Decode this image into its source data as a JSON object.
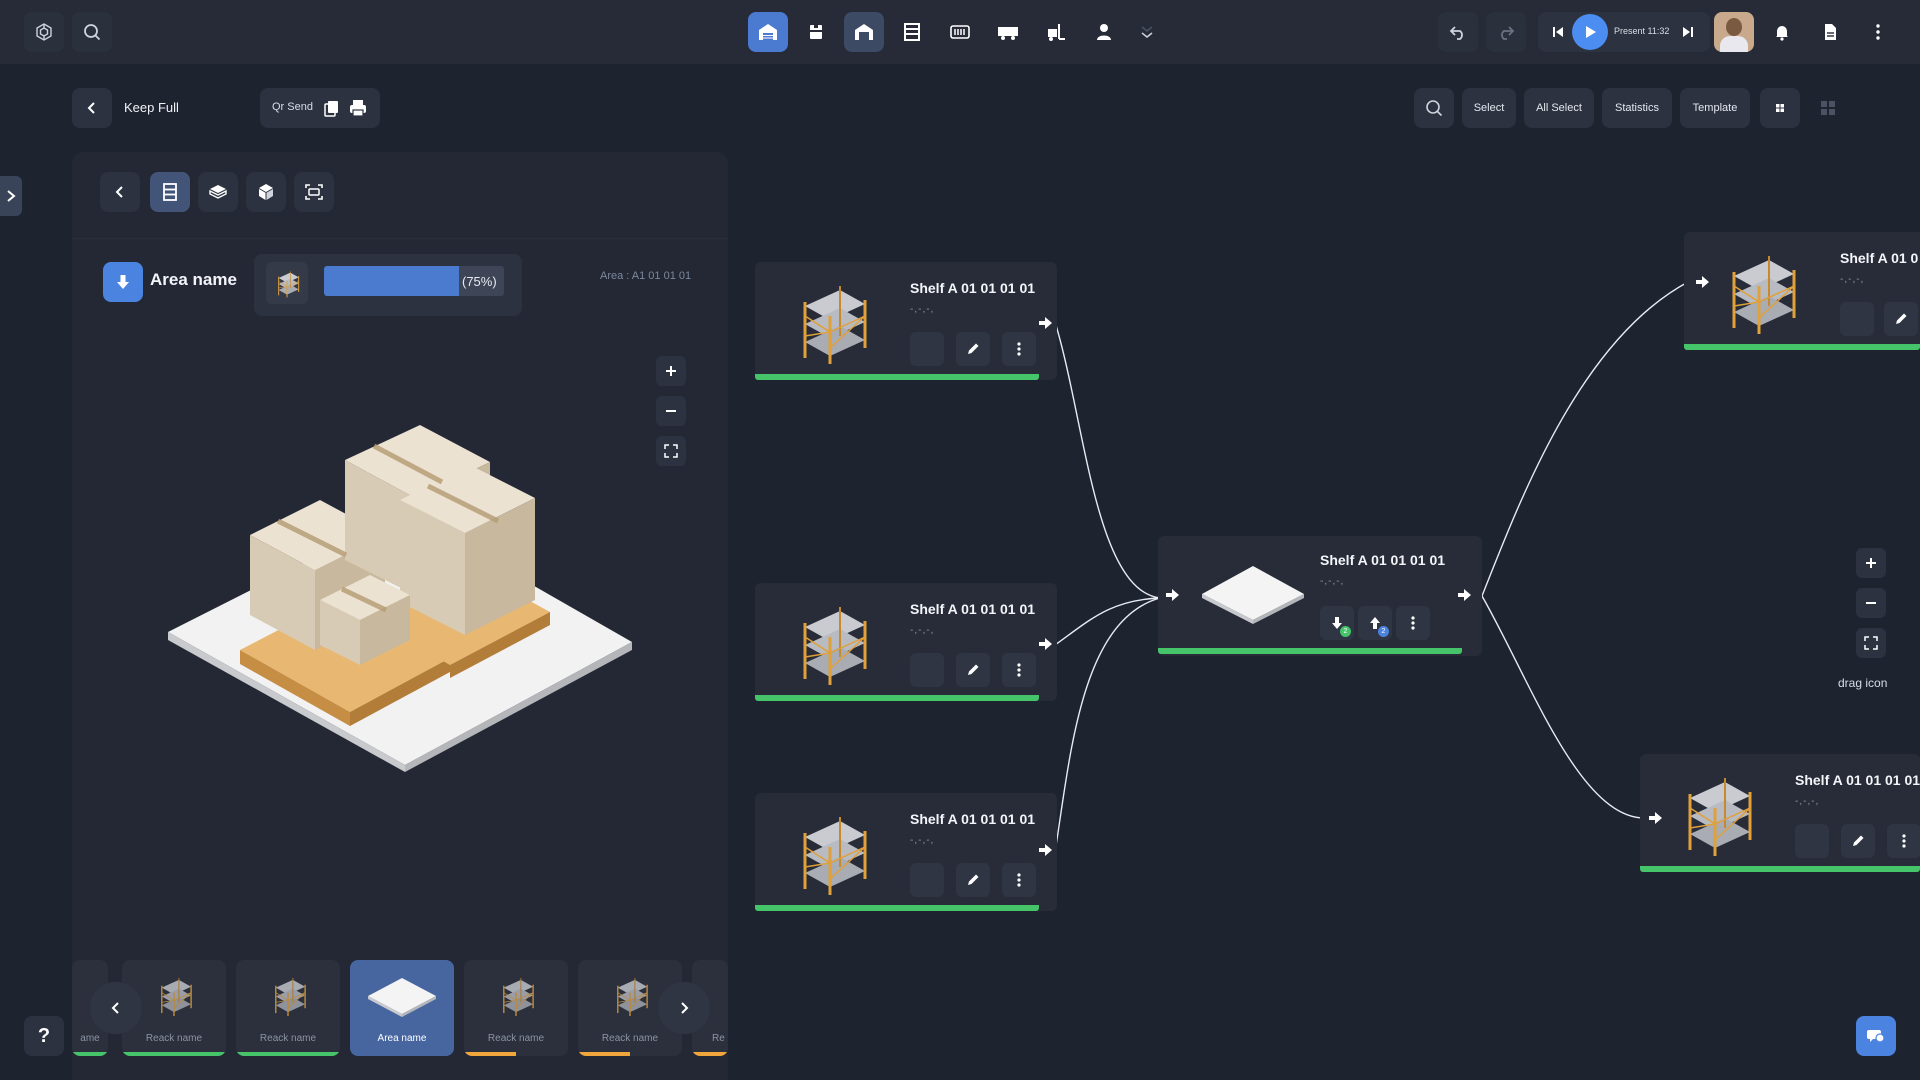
{
  "header": {
    "present_label": "Present 11:32"
  },
  "subheader": {
    "title": "Keep Full",
    "qr_send_label": "Qr Send",
    "actions": [
      "Select",
      "All Select",
      "Statistics",
      "Template"
    ]
  },
  "panel": {
    "area_name": "Area name",
    "progress": 0.75,
    "progress_label": "(75%)",
    "area_code": "Area : A1 01 01 01"
  },
  "flow": {
    "cards": [
      {
        "title": "Shelf A 01 01 01 01",
        "sub": "-,-,-,"
      },
      {
        "title": "Shelf A 01 01 01 01",
        "sub": "-,-,-,"
      },
      {
        "title": "Shelf A 01 01 01 01",
        "sub": "-,-,-,"
      },
      {
        "title": "Shelf A 01 01 01 01",
        "sub": "-,-,-,"
      },
      {
        "title": "Shelf A 01 0",
        "sub": "-,-,-,"
      },
      {
        "title": "Shelf A 01 01 01 01",
        "sub": "-,-,-,"
      }
    ],
    "drag_label": "drag icon",
    "badges": [
      "2",
      "2"
    ]
  },
  "carousel": {
    "items": [
      {
        "label": "ame"
      },
      {
        "label": "Reack name"
      },
      {
        "label": "Reack name"
      },
      {
        "label": "Area name"
      },
      {
        "label": "Reack name"
      },
      {
        "label": "Reack name"
      },
      {
        "label": "Re"
      }
    ]
  },
  "help_label": "?",
  "colors": {
    "accent": "#4b7bd0",
    "green": "#45c46a",
    "orange": "#f0a63a",
    "bg": "#1e2330",
    "panel": "#232834"
  }
}
